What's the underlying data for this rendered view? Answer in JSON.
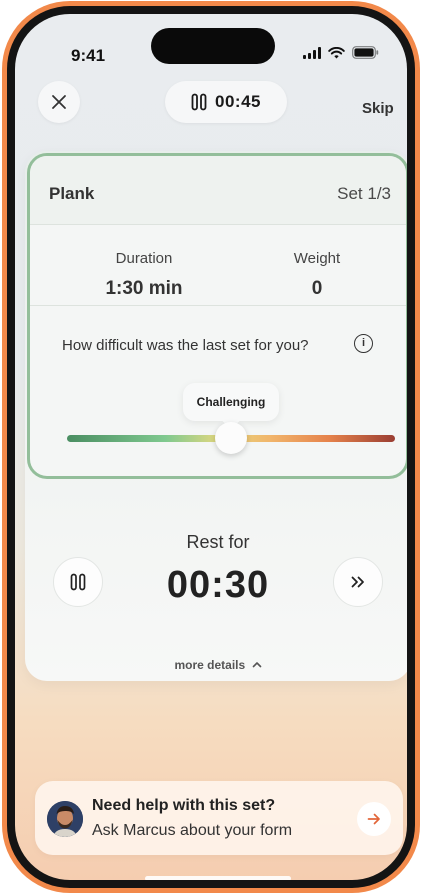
{
  "status_bar": {
    "time": "9:41"
  },
  "header": {
    "timer": "00:45",
    "skip_label": "Skip"
  },
  "exercise": {
    "name": "Plank",
    "set_label": "Set 1/3",
    "stats": [
      {
        "label": "Duration",
        "value": "1:30 min"
      },
      {
        "label": "Weight",
        "value": "0"
      }
    ]
  },
  "difficulty": {
    "question": "How difficult was the last set for you?",
    "selected_label": "Challenging",
    "level": 0.5
  },
  "rest": {
    "label": "Rest for",
    "time": "00:30",
    "more_details": "more details"
  },
  "help": {
    "title": "Need help with this set?",
    "subtitle": "Ask Marcus about your form"
  },
  "colors": {
    "frame": "#F2894A",
    "card_border": "#93BE9A",
    "arrow": "#E2663A"
  },
  "icons": [
    "close-icon",
    "pause-icon",
    "info-icon",
    "fast-forward-icon",
    "chevron-up-icon",
    "arrow-right-icon"
  ]
}
